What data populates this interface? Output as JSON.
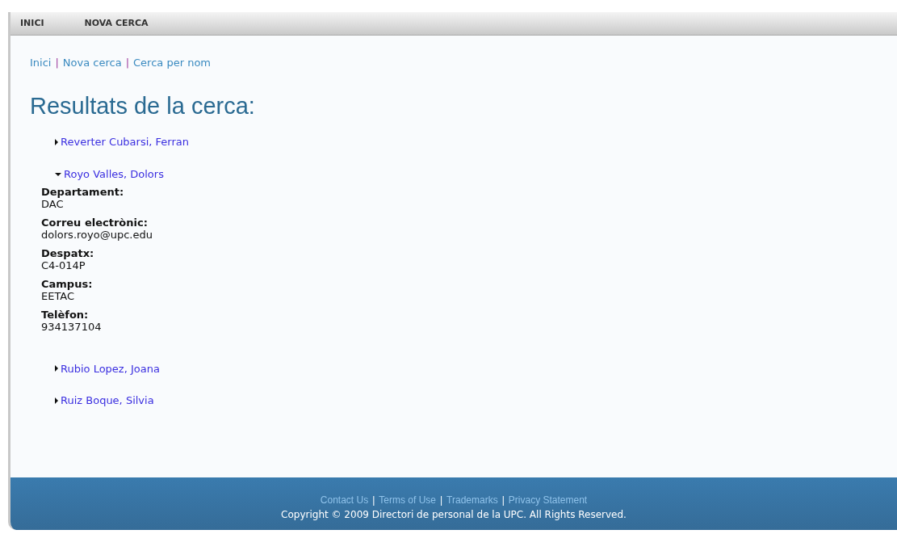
{
  "menu": [
    {
      "label": "INICI"
    },
    {
      "label": "NOVA CERCA"
    }
  ],
  "breadcrumb": {
    "separator": "|",
    "links": [
      "Inici",
      "Nova cerca",
      "Cerca per nom"
    ]
  },
  "title": "Resultats de la cerca:",
  "results": [
    {
      "name": "Reverter Cubarsi, Ferran",
      "expanded": false
    },
    {
      "name": "Royo Valles, Dolors",
      "expanded": true,
      "details": [
        {
          "label": "Departament:",
          "value": "DAC"
        },
        {
          "label": "Correu electrònic:",
          "value": "dolors.royo@upc.edu"
        },
        {
          "label": "Despatx:",
          "value": "C4-014P"
        },
        {
          "label": "Campus:",
          "value": "EETAC"
        },
        {
          "label": "Telèfon:",
          "value": "934137104"
        }
      ]
    },
    {
      "name": "Rubio Lopez, Joana",
      "expanded": false
    },
    {
      "name": "Ruiz Boque, Silvia",
      "expanded": false
    }
  ],
  "footer": {
    "separator": "|",
    "links": [
      "Contact Us",
      "Terms of Use",
      "Trademarks",
      "Privacy Statement"
    ],
    "copyright": "Copyright © 2009 Directori de personal de la UPC. All Rights Reserved."
  }
}
